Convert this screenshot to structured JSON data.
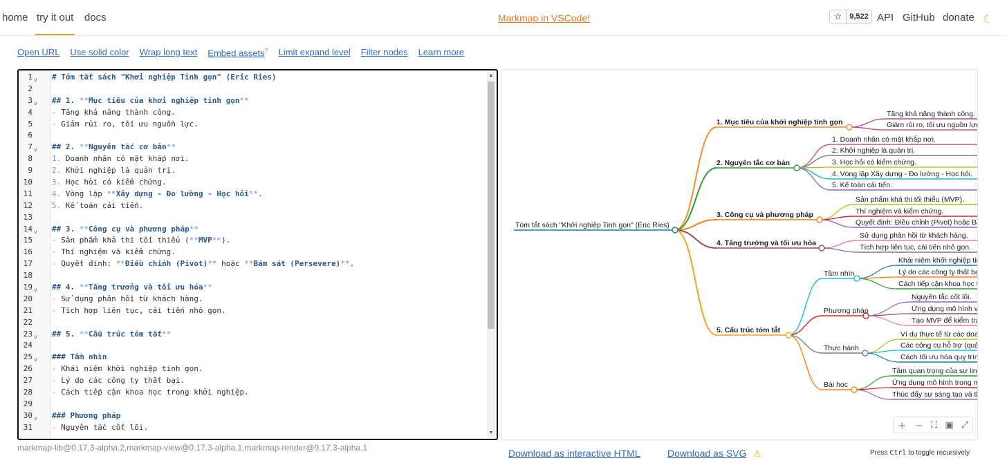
{
  "nav": {
    "home": "home",
    "try": "try it out",
    "docs": "docs",
    "promo": "Markmap in VSCode!",
    "star_count": "9,522",
    "api": "API",
    "github": "GitHub",
    "donate": "donate"
  },
  "toolbar": [
    "Open URL",
    "Use solid color",
    "Wrap long text",
    "Embed assets",
    "Limit expand level",
    "Filter nodes",
    "Learn more"
  ],
  "embed_sup": "?",
  "editor_lines": [
    [
      {
        "t": "# Tóm tắt sách \"Khởi nghiệp Tinh gọn\" (Eric Ries)",
        "c": "h"
      }
    ],
    [],
    [
      {
        "t": "## 1. ",
        "c": "h"
      },
      {
        "t": "**",
        "c": "m"
      },
      {
        "t": "Mục tiêu của khởi nghiệp tinh gọn",
        "c": "b"
      },
      {
        "t": "**",
        "c": "m"
      }
    ],
    [
      {
        "t": "- ",
        "c": "m"
      },
      {
        "t": "Tăng khả năng thành công.",
        "c": ""
      }
    ],
    [
      {
        "t": "- ",
        "c": "m"
      },
      {
        "t": "Giảm rủi ro, tối ưu nguồn lực.",
        "c": ""
      }
    ],
    [],
    [
      {
        "t": "## 2. ",
        "c": "h"
      },
      {
        "t": "**",
        "c": "m"
      },
      {
        "t": "Nguyên tắc cơ bản",
        "c": "b"
      },
      {
        "t": "**",
        "c": "m"
      }
    ],
    [
      {
        "t": "1. ",
        "c": "m"
      },
      {
        "t": "Doanh nhân có mặt khắp nơi.",
        "c": ""
      }
    ],
    [
      {
        "t": "2. ",
        "c": "m"
      },
      {
        "t": "Khởi nghiệp là quản trị.",
        "c": ""
      }
    ],
    [
      {
        "t": "3. ",
        "c": "m"
      },
      {
        "t": "Học hỏi có kiểm chứng.",
        "c": ""
      }
    ],
    [
      {
        "t": "4. ",
        "c": "m"
      },
      {
        "t": "Vòng lặp ",
        "c": ""
      },
      {
        "t": "**",
        "c": "m"
      },
      {
        "t": "Xây dựng - Đo lường - Học hỏi",
        "c": "b"
      },
      {
        "t": "**",
        "c": "m"
      },
      {
        "t": ".",
        "c": ""
      }
    ],
    [
      {
        "t": "5. ",
        "c": "m"
      },
      {
        "t": "Kế toán cải tiến.",
        "c": ""
      }
    ],
    [],
    [
      {
        "t": "## 3. ",
        "c": "h"
      },
      {
        "t": "**",
        "c": "m"
      },
      {
        "t": "Công cụ và phương pháp",
        "c": "b"
      },
      {
        "t": "**",
        "c": "m"
      }
    ],
    [
      {
        "t": "- ",
        "c": "m"
      },
      {
        "t": "Sản phẩm khả thi tối thiểu (",
        "c": ""
      },
      {
        "t": "**",
        "c": "m"
      },
      {
        "t": "MVP",
        "c": "b"
      },
      {
        "t": "**",
        "c": "m"
      },
      {
        "t": ").",
        "c": ""
      }
    ],
    [
      {
        "t": "- ",
        "c": "m"
      },
      {
        "t": "Thí nghiệm và kiểm chứng.",
        "c": ""
      }
    ],
    [
      {
        "t": "- ",
        "c": "m"
      },
      {
        "t": "Quyết định: ",
        "c": ""
      },
      {
        "t": "**",
        "c": "m"
      },
      {
        "t": "Điều chỉnh (Pivot)",
        "c": "b"
      },
      {
        "t": "**",
        "c": "m"
      },
      {
        "t": " hoặc ",
        "c": ""
      },
      {
        "t": "**",
        "c": "m"
      },
      {
        "t": "Bám sát (Persevere)",
        "c": "b"
      },
      {
        "t": "**",
        "c": "m"
      },
      {
        "t": ".",
        "c": ""
      }
    ],
    [],
    [
      {
        "t": "## 4. ",
        "c": "h"
      },
      {
        "t": "**",
        "c": "m"
      },
      {
        "t": "Tăng trưởng và tối ưu hóa",
        "c": "b"
      },
      {
        "t": "**",
        "c": "m"
      }
    ],
    [
      {
        "t": "- ",
        "c": "m"
      },
      {
        "t": "Sử dụng phản hồi từ khách hàng.",
        "c": ""
      }
    ],
    [
      {
        "t": "- ",
        "c": "m"
      },
      {
        "t": "Tích hợp liên tục, cải tiến nhỏ gọn.",
        "c": ""
      }
    ],
    [],
    [
      {
        "t": "## 5. ",
        "c": "h"
      },
      {
        "t": "**",
        "c": "m"
      },
      {
        "t": "Cấu trúc tóm tắt",
        "c": "b"
      },
      {
        "t": "**",
        "c": "m"
      }
    ],
    [],
    [
      {
        "t": "### Tầm nhìn",
        "c": "h"
      }
    ],
    [
      {
        "t": "- ",
        "c": "m"
      },
      {
        "t": "Khái niệm khởi nghiệp tinh gọn.",
        "c": ""
      }
    ],
    [
      {
        "t": "- ",
        "c": "m"
      },
      {
        "t": "Lý do các công ty thất bại.",
        "c": ""
      }
    ],
    [
      {
        "t": "- ",
        "c": "m"
      },
      {
        "t": "Cách tiếp cận khoa học trong khởi nghiệp.",
        "c": ""
      }
    ],
    [],
    [
      {
        "t": "### Phương pháp",
        "c": "h"
      }
    ],
    [
      {
        "t": "- ",
        "c": "m"
      },
      {
        "t": "Nguyên tắc cốt lõi.",
        "c": ""
      }
    ]
  ],
  "mindmap": {
    "root": "Tóm tắt sách \"Khởi nghiệp Tinh gọn\" (Eric Ries)",
    "branches": [
      {
        "label": "1. Mục tiêu của khởi nghiệp tinh gọn",
        "color": "#f28e2b",
        "children": [
          {
            "label": "Tăng khả năng thành công.",
            "color": "#a05195"
          },
          {
            "label": "Giảm rủi ro, tối ưu nguồn lực.",
            "color": "#d45087"
          }
        ]
      },
      {
        "label": "2. Nguyên tắc cơ bản",
        "color": "#2ca02c",
        "children": [
          {
            "label": "1. Doanh nhân có mặt khắp nơi.",
            "color": "#d45087"
          },
          {
            "label": "2. Khởi nghiệp là quản trị.",
            "color": "#7f7f7f"
          },
          {
            "label": "3. Học hỏi có kiểm chứng.",
            "color": "#bcbd22"
          },
          {
            "label": "4. Vòng lặp Xây dựng - Đo lường - Học hỏi.",
            "color": "#17becf"
          },
          {
            "label": "5. Kế toán cải tiến.",
            "color": "#9467bd"
          }
        ]
      },
      {
        "label": "3. Công cụ và phương pháp",
        "color": "#ff7f0e",
        "children": [
          {
            "label": "Sản phẩm khả thi tối thiểu (MVP).",
            "color": "#bcbd22"
          },
          {
            "label": "Thí nghiệm và kiểm chứng.",
            "color": "#d62728"
          },
          {
            "label": "Quyết định: Điều chỉnh (Pivot) hoặc Bám sát (Persevere).",
            "color": "#9467bd"
          }
        ]
      },
      {
        "label": "4. Tăng trưởng và tối ưu hóa",
        "color": "#8c564b",
        "children": [
          {
            "label": "Sử dụng phản hồi từ khách hàng.",
            "color": "#e377c2"
          },
          {
            "label": "Tích hợp liên tục, cải tiến nhỏ gọn.",
            "color": "#7f7f7f"
          }
        ]
      },
      {
        "label": "5. Cấu trúc tóm tắt",
        "color": "#ff9f1c",
        "children": [
          {
            "label": "Tầm nhìn",
            "color": "#17becf",
            "children": [
              {
                "label": "Khái niệm khởi nghiệp tinh gọn.",
                "color": "#1f77b4"
              },
              {
                "label": "Lý do các công ty thất bại.",
                "color": "#ff7f0e"
              },
              {
                "label": "Cách tiếp cận khoa học trong khởi nghiệp.",
                "color": "#2ca02c"
              }
            ]
          },
          {
            "label": "Phương pháp",
            "color": "#d62728",
            "children": [
              {
                "label": "Nguyên tắc cốt lõi.",
                "color": "#9467bd"
              },
              {
                "label": "Ứng dụng mô hình vào thực tế.",
                "color": "#8c564b"
              },
              {
                "label": "Tạo MVP để kiểm tra giả thuyết.",
                "color": "#e377c2"
              }
            ]
          },
          {
            "label": "Thực hành",
            "color": "#7f7f7f",
            "children": [
              {
                "label": "Ví dụ thực tế từ các doanh nghiệp.",
                "color": "#bcbd22"
              },
              {
                "label": "Các công cụ hỗ trợ (quản lý).",
                "color": "#17becf"
              },
              {
                "label": "Cách tối ưu hóa quy trình.",
                "color": "#1f77b4"
              }
            ]
          },
          {
            "label": "Bài học",
            "color": "#ff7f0e",
            "children": [
              {
                "label": "Tầm quan trọng của sự linh hoạt.",
                "color": "#2ca02c"
              },
              {
                "label": "Ứng dụng mô hình trong mọi lĩnh vực.",
                "color": "#d62728"
              },
              {
                "label": "Thúc đẩy sự sáng tạo và thử nghiệm.",
                "color": "#9467bd"
              }
            ]
          }
        ]
      }
    ]
  },
  "footer": {
    "versions": "markmap-lib@0.17.3-alpha.2,markmap-view@0.17.3-alpha.1,markmap-render@0.17.3-alpha.1",
    "dl_html": "Download as interactive HTML",
    "dl_svg": "Download as SVG",
    "hint_pre": "Press ",
    "hint_key": "Ctrl",
    "hint_post": " to toggle recursively"
  }
}
